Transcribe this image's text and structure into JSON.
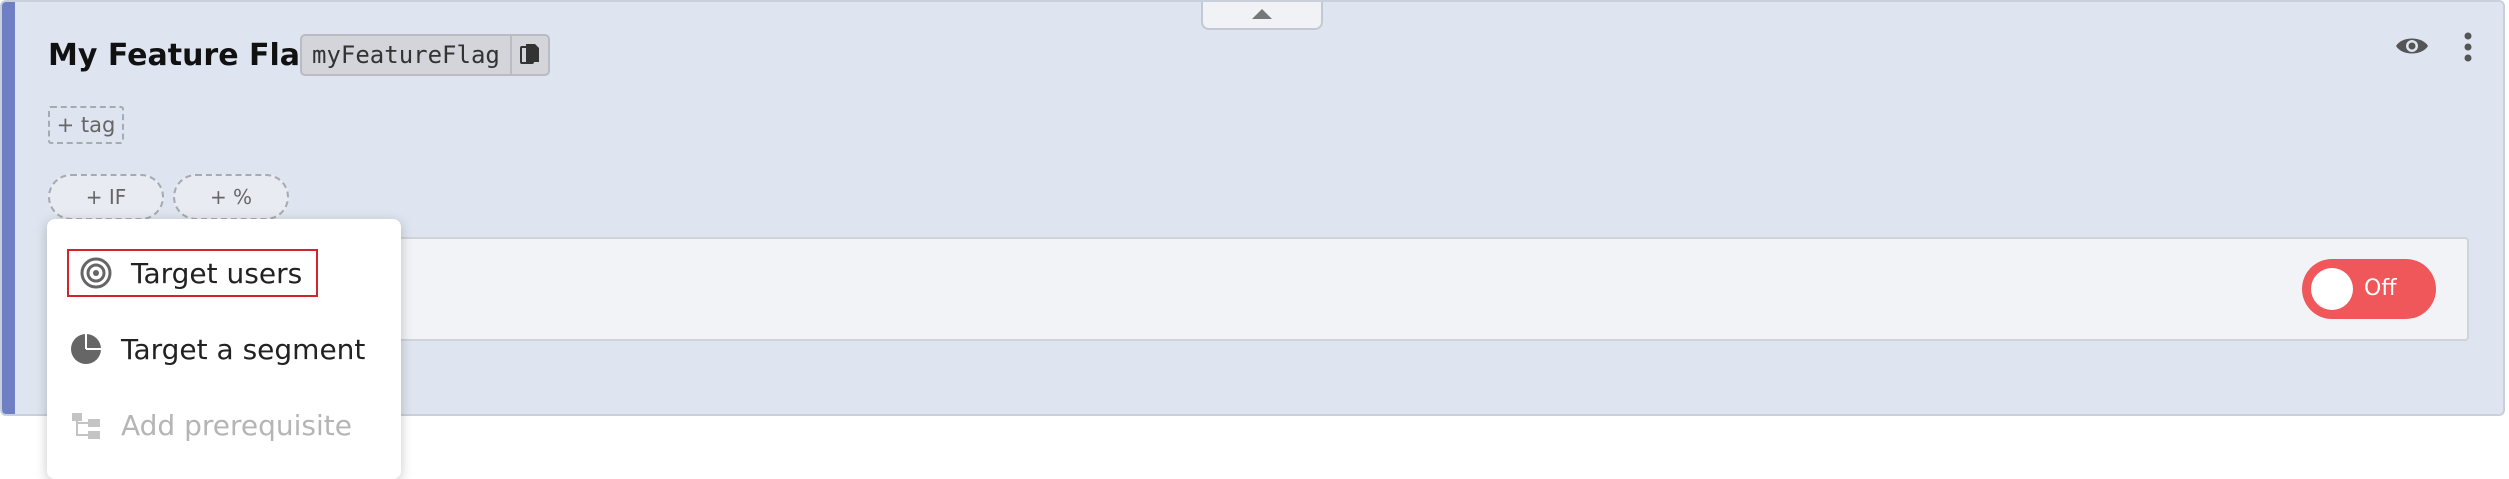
{
  "flag": {
    "name": "My Feature Flag",
    "key": "myFeatureFlag"
  },
  "tags": {
    "add_label": "+ tag"
  },
  "rule_buttons": {
    "add_if_label": "+ IF",
    "add_percent_label": "+ %"
  },
  "toggle": {
    "state_label": "Off",
    "color": "#f0575a"
  },
  "menu": {
    "items": [
      {
        "label": "Target users",
        "icon": "target-icon",
        "highlighted": true,
        "disabled": false
      },
      {
        "label": "Target a segment",
        "icon": "pie-segment-icon",
        "highlighted": false,
        "disabled": false
      },
      {
        "label": "Add prerequisite",
        "icon": "prerequisite-icon",
        "highlighted": false,
        "disabled": true
      }
    ]
  },
  "colors": {
    "card_bg": "#dfe5f0",
    "accent": "#6e7fc4",
    "highlight_outline": "#d0262b"
  }
}
